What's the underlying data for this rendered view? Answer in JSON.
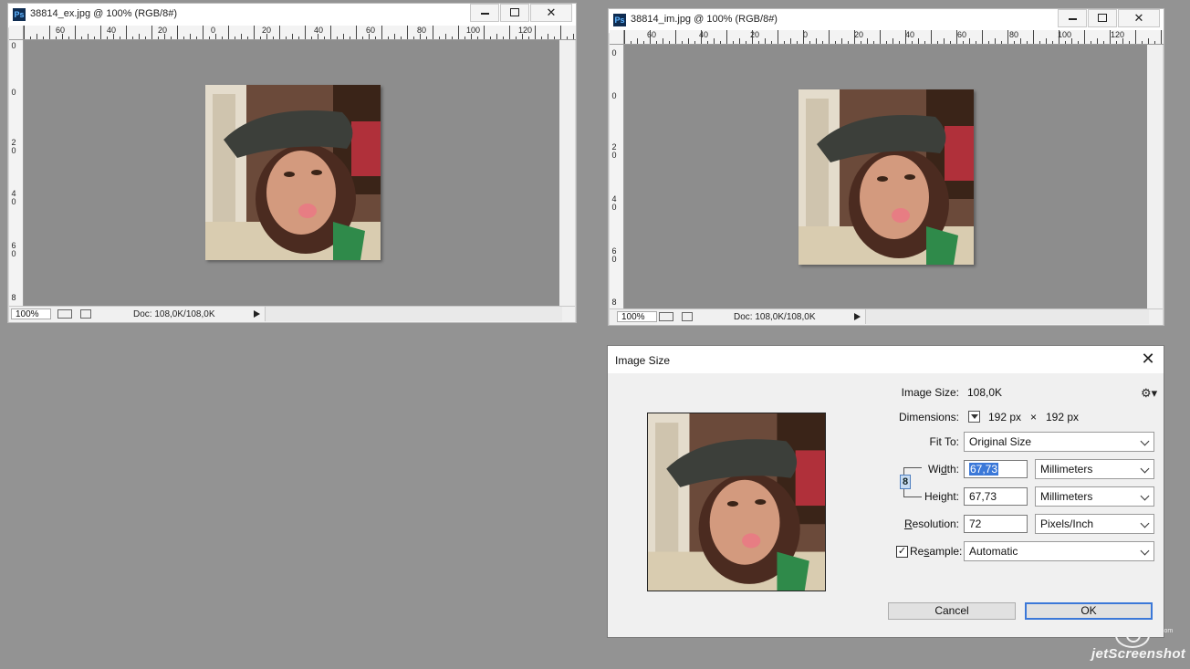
{
  "windows": [
    {
      "title": "38814_ex.jpg @ 100% (RGB/8#)",
      "zoom": "100%",
      "doc_info": "Doc: 108,0K/108,0K",
      "ruler_top_labels": [
        "60",
        "40",
        "20",
        "0",
        "20",
        "40",
        "60",
        "80",
        "100",
        "120"
      ],
      "ruler_left_labels": [
        "0",
        "0",
        "2\n0",
        "4\n0",
        "6\n0",
        "8"
      ]
    },
    {
      "title": "38814_im.jpg @ 100% (RGB/8#)",
      "zoom": "100%",
      "doc_info": "Doc: 108,0K/108,0K",
      "ruler_top_labels": [
        "60",
        "40",
        "20",
        "0",
        "20",
        "40",
        "60",
        "80",
        "100",
        "120"
      ],
      "ruler_left_labels": [
        "0",
        "0",
        "2\n0",
        "4\n0",
        "6\n0",
        "8"
      ]
    }
  ],
  "dialog": {
    "title": "Image Size",
    "image_size_label": "Image Size:",
    "image_size_value": "108,0K",
    "dimensions_label": "Dimensions:",
    "dim_w": "192 px",
    "dim_x": "×",
    "dim_h": "192 px",
    "fit_to_label": "Fit To:",
    "fit_to_value": "Original Size",
    "width_label_pre": "Wi",
    "width_label_u": "d",
    "width_label_post": "th:",
    "width_value": "67,73",
    "width_unit": "Millimeters",
    "height_label_pre": "Hei",
    "height_label_u": "g",
    "height_label_post": "ht:",
    "height_value": "67,73",
    "height_unit": "Millimeters",
    "resolution_label_u": "R",
    "resolution_label_post": "esolution:",
    "resolution_value": "72",
    "resolution_unit": "Pixels/Inch",
    "resample_label_pre": "Re",
    "resample_label_u": "s",
    "resample_label_post": "ample:",
    "resample_checked": "✓",
    "resample_value": "Automatic",
    "cancel_label": "Cancel",
    "ok_label": "OK",
    "gear": "⚙▾",
    "chain": "8"
  },
  "watermark": {
    "text": "jetScreenshot",
    "small": ".com"
  },
  "colors": {
    "desktop": "#939393",
    "canvas": "#8d8d8d",
    "accent": "#3b78d8"
  }
}
